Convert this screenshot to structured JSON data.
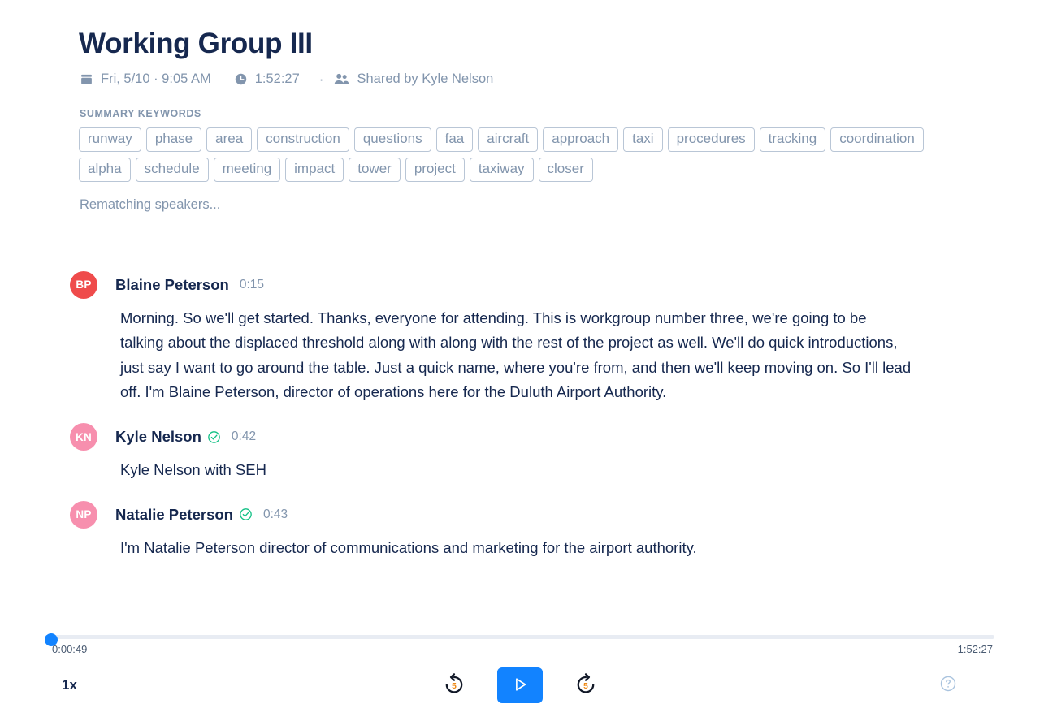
{
  "header": {
    "title": "Working Group III",
    "date_icon": "calendar-icon",
    "date": "Fri, 5/10 · 9:05 AM",
    "duration_icon": "clock-icon",
    "duration": "1:52:27",
    "separator": "·",
    "shared_icon": "people-icon",
    "shared_by": "Shared by Kyle Nelson"
  },
  "keywords": {
    "label": "SUMMARY KEYWORDS",
    "tags": [
      "runway",
      "phase",
      "area",
      "construction",
      "questions",
      "faa",
      "aircraft",
      "approach",
      "taxi",
      "procedures",
      "tracking",
      "coordination",
      "alpha",
      "schedule",
      "meeting",
      "impact",
      "tower",
      "project",
      "taxiway",
      "closer"
    ],
    "status": "Rematching speakers..."
  },
  "transcript": {
    "turns": [
      {
        "initials": "BP",
        "avatar_color": "#ef4b4b",
        "name": "Blaine Peterson",
        "verified": false,
        "time": "0:15",
        "text": "Morning. So we'll get started. Thanks, everyone for attending. This is workgroup number three, we're going to be talking about the displaced threshold along with along with the rest of the project as well. We'll do quick introductions, just say I want to go around the table. Just a quick name, where you're from, and then we'll keep moving on. So I'll lead off. I'm Blaine Peterson, director of operations here for the Duluth Airport Authority."
      },
      {
        "initials": "KN",
        "avatar_color": "#f78fae",
        "name": "Kyle Nelson",
        "verified": true,
        "time": "0:42",
        "text": "Kyle Nelson with SEH"
      },
      {
        "initials": "NP",
        "avatar_color": "#f78fae",
        "name": "Natalie Peterson",
        "verified": true,
        "time": "0:43",
        "text": "I'm Natalie Peterson director of communications and marketing for the airport authority."
      }
    ]
  },
  "player": {
    "current_time": "0:00:49",
    "total_time": "1:52:27",
    "speed": "1x",
    "rewind_seconds": "5",
    "forward_seconds": "5",
    "play_icon": "play-icon",
    "rewind_icon": "rewind-5-icon",
    "forward_icon": "forward-5-icon",
    "help_icon": "help-circle-icon",
    "accent_color": "#1283ff"
  }
}
